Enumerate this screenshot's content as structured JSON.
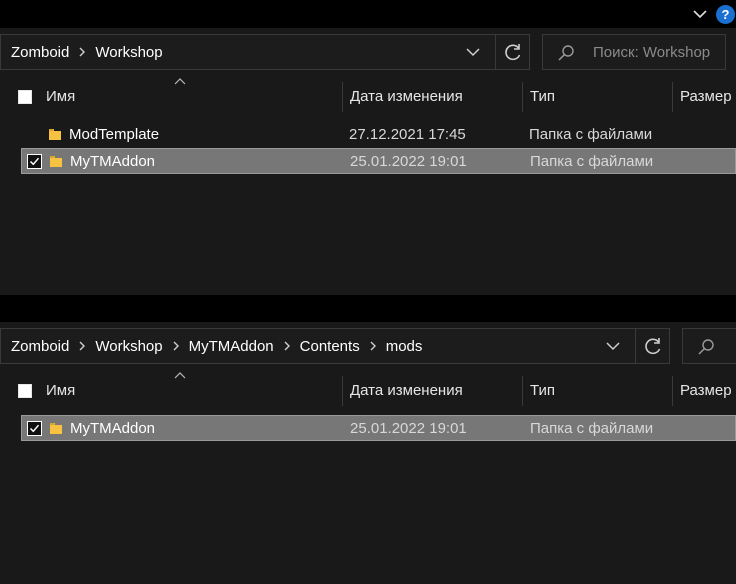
{
  "top": {
    "help_label": "?"
  },
  "pane1": {
    "breadcrumbs": [
      "Zomboid",
      "Workshop"
    ],
    "search_placeholder": "Поиск: Workshop",
    "columns": {
      "name": "Имя",
      "date": "Дата изменения",
      "type": "Тип",
      "size": "Размер"
    },
    "rows": [
      {
        "name": "ModTemplate",
        "date": "27.12.2021 17:45",
        "type": "Папка с файлами",
        "selected": false
      },
      {
        "name": "MyTMAddon",
        "date": "25.01.2022 19:01",
        "type": "Папка с файлами",
        "selected": true
      }
    ]
  },
  "pane2": {
    "breadcrumbs": [
      "Zomboid",
      "Workshop",
      "MyTMAddon",
      "Contents",
      "mods"
    ],
    "columns": {
      "name": "Имя",
      "date": "Дата изменения",
      "type": "Тип",
      "size": "Размер"
    },
    "rows": [
      {
        "name": "MyTMAddon",
        "date": "25.01.2022 19:01",
        "type": "Папка с файлами",
        "selected": true
      }
    ]
  },
  "colors": {
    "folder": "#f5c242",
    "selected_row": "#777777",
    "help": "#1a6fd1"
  }
}
